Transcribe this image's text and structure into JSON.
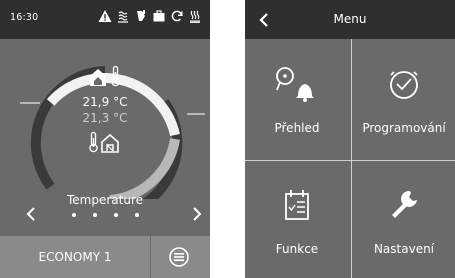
{
  "status_bar": {
    "time": "16:30",
    "icons": [
      "warning-icon",
      "water-heater-icon",
      "filter-icon",
      "briefcase-icon",
      "refresh-icon",
      "defrost-icon"
    ]
  },
  "thermostat": {
    "indoor_temp": "21,9 °C",
    "outdoor_temp": "21,3 °C",
    "page_label": "Temperature",
    "page_dots": 4,
    "active_page": 1
  },
  "mode_bar": {
    "mode_label": "ECONOMY 1"
  },
  "menu": {
    "title": "Menu",
    "items": [
      {
        "label": "Přehled",
        "icon": "overview-bell-icon"
      },
      {
        "label": "Programování",
        "icon": "clock-check-icon"
      },
      {
        "label": "Funkce",
        "icon": "calendar-list-icon"
      },
      {
        "label": "Nastavení",
        "icon": "wrench-icon"
      }
    ]
  },
  "colors": {
    "background": "#6a6a6a",
    "header": "#2f2f2f",
    "mode_bar": "#8a8a8a",
    "arc_light": "#f2f2f2",
    "arc_dark": "#3a3a3a",
    "arc_gray": "#b8b8b8"
  }
}
